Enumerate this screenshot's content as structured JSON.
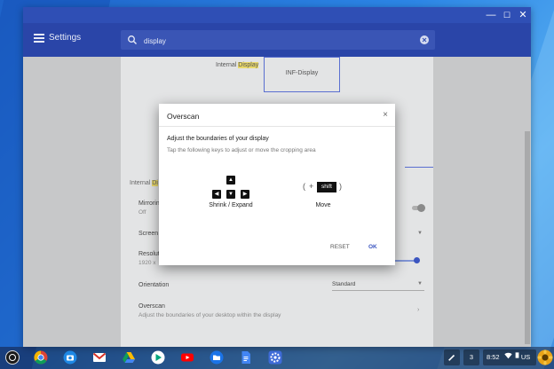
{
  "settings": {
    "title": "Settings",
    "search_value": "display",
    "arrangement": {
      "internal_label_prefix": "Internal ",
      "internal_label_highlight": "Display",
      "external_label": "INF-Display"
    },
    "section_label_prefix": "Internal ",
    "section_label_highlight": "Di",
    "rows": {
      "mirroring_label": "Mirroring",
      "mirroring_sub": "Off",
      "screen_label": "Screen",
      "resolution_label": "Resolution",
      "resolution_sub": "1920 x",
      "orientation_label": "Orientation",
      "orientation_value": "Standard",
      "overscan_label": "Overscan",
      "overscan_sub": "Adjust the boundaries of your desktop within the display"
    }
  },
  "dialog": {
    "title": "Overscan",
    "heading": "Adjust the boundaries of your display",
    "subtext": "Tap the following keys to adjust or move the cropping area",
    "shrink_label": "Shrink / Expand",
    "move_label": "Move",
    "plus": "+",
    "open_paren": "(",
    "close_paren": ")",
    "shift_key": "shift",
    "reset_label": "RESET",
    "ok_label": "OK",
    "close_glyph": "×"
  },
  "window_controls": {
    "minimize": "—",
    "maximize": "☐",
    "close": "✕"
  },
  "tray": {
    "notifications": "3",
    "time": "8:52",
    "locale": "US"
  },
  "colors": {
    "accent": "#3b55c0",
    "appbar": "#2a45a8",
    "titlebar": "#2f4fb5"
  },
  "icons": [
    "hamburger-menu-icon",
    "search-icon",
    "clear-icon",
    "close-icon",
    "arrow-up-icon",
    "arrow-left-icon",
    "arrow-down-icon",
    "arrow-right-icon",
    "launcher-icon",
    "chrome-icon",
    "camera-icon",
    "gmail-icon",
    "drive-icon",
    "play-store-icon",
    "youtube-icon",
    "files-icon",
    "docs-icon",
    "settings-icon",
    "stylus-icon",
    "wifi-icon",
    "battery-icon",
    "avatar"
  ]
}
